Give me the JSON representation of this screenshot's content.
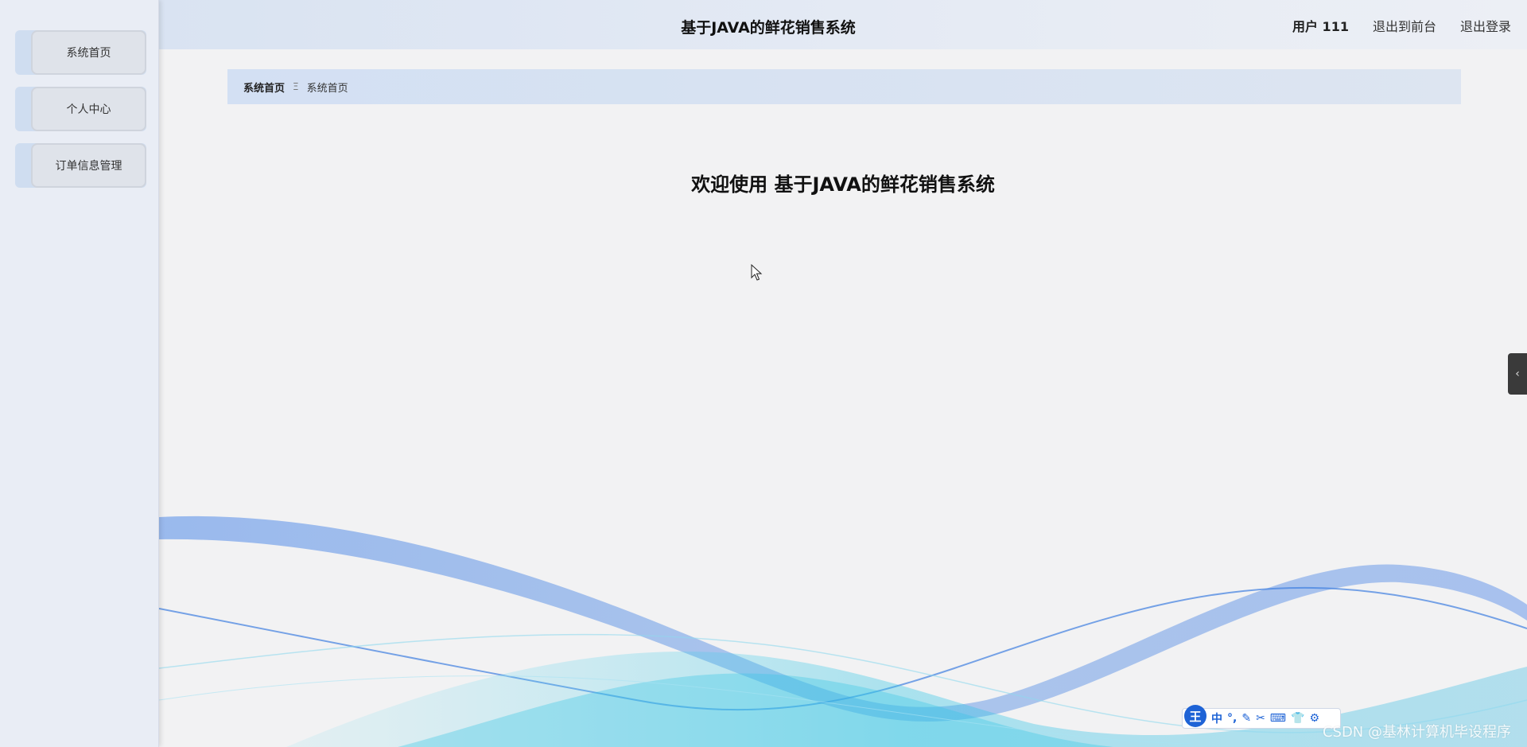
{
  "app": {
    "title": "基于JAVA的鲜花销售系统"
  },
  "sidebar": {
    "items": [
      {
        "label": "系统首页"
      },
      {
        "label": "个人中心"
      },
      {
        "label": "订单信息管理"
      }
    ]
  },
  "header": {
    "title": "基于JAVA的鲜花销售系统",
    "user": "用户 111",
    "back_to_front": "退出到前台",
    "logout": "退出登录"
  },
  "breadcrumb": {
    "items": [
      "系统首页",
      "系统首页"
    ],
    "separator": "Ξ"
  },
  "main": {
    "welcome": "欢迎使用 基于JAVA的鲜花销售系统"
  },
  "ime": {
    "logo": "王",
    "mode": "中",
    "items": [
      "°,",
      "✎",
      "✂",
      "⌨",
      "👕",
      "⚙"
    ]
  },
  "watermark": "CSDN @基林计算机毕设程序",
  "colors": {
    "sidebar_bg": "#e9edf5",
    "header_bg": "#d9e3f2",
    "wave_blue": "#4a86e8",
    "wave_cyan": "#35c7e6"
  }
}
